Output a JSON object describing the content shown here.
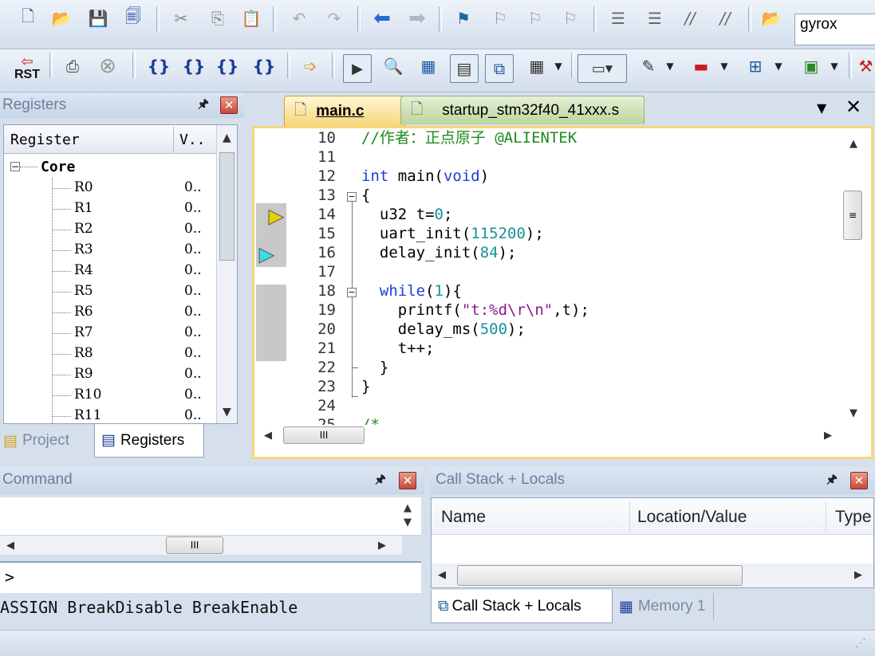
{
  "toolbar1": {
    "combo_value": "gyrox"
  },
  "toolbar2": {
    "rst_label": "RST"
  },
  "registers_panel": {
    "title": "Registers",
    "col_register": "Register",
    "col_value": "V..",
    "group": "Core",
    "rows": [
      {
        "name": "R0",
        "value": "0.."
      },
      {
        "name": "R1",
        "value": "0.."
      },
      {
        "name": "R2",
        "value": "0.."
      },
      {
        "name": "R3",
        "value": "0.."
      },
      {
        "name": "R4",
        "value": "0.."
      },
      {
        "name": "R5",
        "value": "0.."
      },
      {
        "name": "R6",
        "value": "0.."
      },
      {
        "name": "R7",
        "value": "0.."
      },
      {
        "name": "R8",
        "value": "0.."
      },
      {
        "name": "R9",
        "value": "0.."
      },
      {
        "name": "R10",
        "value": "0.."
      },
      {
        "name": "R11",
        "value": "0.."
      }
    ],
    "tab_project": "Project",
    "tab_registers": "Registers"
  },
  "editor": {
    "tab_main": "main.c",
    "tab_startup": "startup_stm32f40_41xxx.s",
    "line_numbers": [
      "10",
      "11",
      "12",
      "13",
      "14",
      "15",
      "16",
      "17",
      "18",
      "19",
      "20",
      "21",
      "22",
      "23",
      "24",
      "25"
    ],
    "hscroll_grip": "III"
  },
  "command_panel": {
    "title": "Command",
    "prompt": ">",
    "hint": "ASSIGN BreakDisable BreakEnable",
    "hscroll_grip": "III"
  },
  "callstack_panel": {
    "title": "Call Stack + Locals",
    "col_name": "Name",
    "col_location": "Location/Value",
    "col_type": "Type",
    "tab_callstack": "Call Stack + Locals",
    "tab_memory": "Memory 1"
  }
}
